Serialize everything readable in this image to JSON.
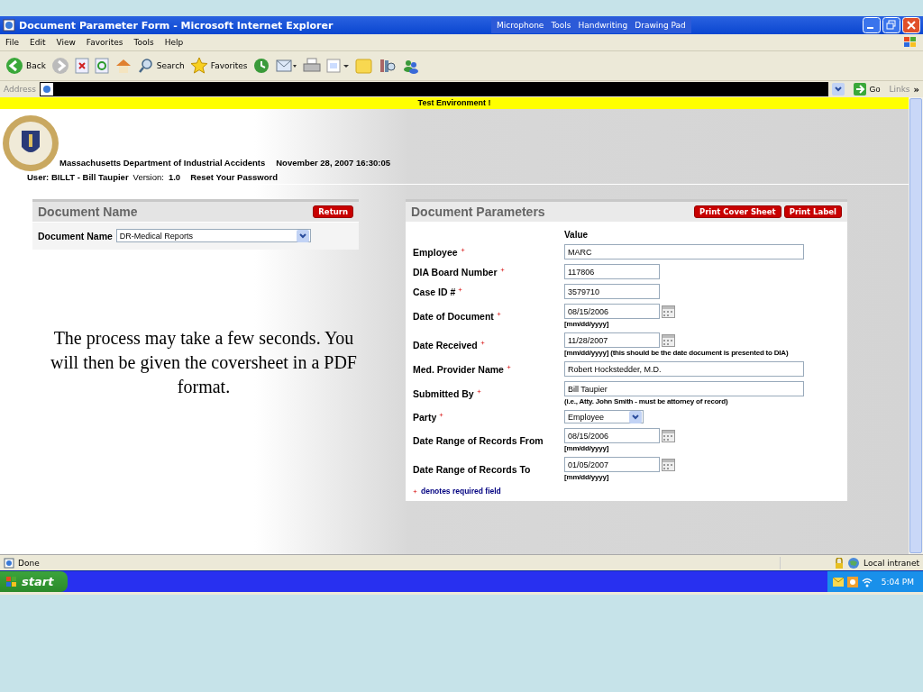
{
  "window": {
    "title": "Document Parameter Form - Microsoft Internet Explorer"
  },
  "language_bar": [
    "Microphone",
    "Tools",
    "Handwriting",
    "Drawing Pad"
  ],
  "menu": [
    "File",
    "Edit",
    "View",
    "Favorites",
    "Tools",
    "Help"
  ],
  "toolbar": {
    "back": "Back",
    "search": "Search",
    "favorites": "Favorites"
  },
  "address_bar": {
    "label": "Address",
    "go": "Go",
    "links": "Links",
    "more": "»"
  },
  "page": {
    "banner": "Test Environment !",
    "header": {
      "agency": "Massachusetts Department of Industrial Accidents",
      "datetime": "November 28, 2007 16:30:05",
      "user": "User:  BILLT  -  Bill Taupier",
      "version_label": "Version:",
      "version": "1.0",
      "reset_link": "Reset Your Password"
    },
    "document_name_panel": {
      "title": "Document Name",
      "button": "Return",
      "field_label": "Document Name",
      "value": "DR-Medical Reports"
    },
    "parameters_panel": {
      "title": "Document Parameters",
      "buttons": [
        "Print Cover Sheet",
        "Print Label"
      ],
      "column_header": "Value",
      "fields": [
        {
          "label": "Employee",
          "kind": "longtext",
          "required": true,
          "value": "MARC"
        },
        {
          "label": "DIA Board Number",
          "kind": "text",
          "required": true,
          "value": "117806"
        },
        {
          "label": "Case ID #",
          "kind": "text",
          "required": true,
          "value": "3579710"
        },
        {
          "label": "Date of Document",
          "kind": "date",
          "required": true,
          "value": "08/15/2006",
          "hint": "[mm/dd/yyyy]"
        },
        {
          "label": "Date Received",
          "kind": "date",
          "required": true,
          "value": "11/28/2007",
          "hint": "[mm/dd/yyyy] (this should be the date document is presented to DIA)"
        },
        {
          "label": "Med. Provider Name",
          "kind": "longtext",
          "required": true,
          "value": "Robert Hockstedder, M.D."
        },
        {
          "label": "Submitted By",
          "kind": "longtext",
          "required": true,
          "value": "Bill Taupier",
          "hint": "(i.e., Atty. John Smith - must be attorney of record)"
        },
        {
          "label": "Party",
          "kind": "select",
          "required": true,
          "value": "Employee"
        },
        {
          "label": "Date Range of Records From",
          "kind": "date",
          "required": false,
          "value": "08/15/2006",
          "hint": "[mm/dd/yyyy]"
        },
        {
          "label": "Date Range of Records To",
          "kind": "date",
          "required": false,
          "value": "01/05/2007",
          "hint": "[mm/dd/yyyy]"
        }
      ],
      "footnote": "denotes required field"
    }
  },
  "slide_caption": "The process may take a few seconds.  You will then be given the coversheet in a PDF format.",
  "status_bar": {
    "status": "Done",
    "zone": "Local intranet"
  },
  "taskbar": {
    "start": "start",
    "clock": "5:04 PM"
  }
}
